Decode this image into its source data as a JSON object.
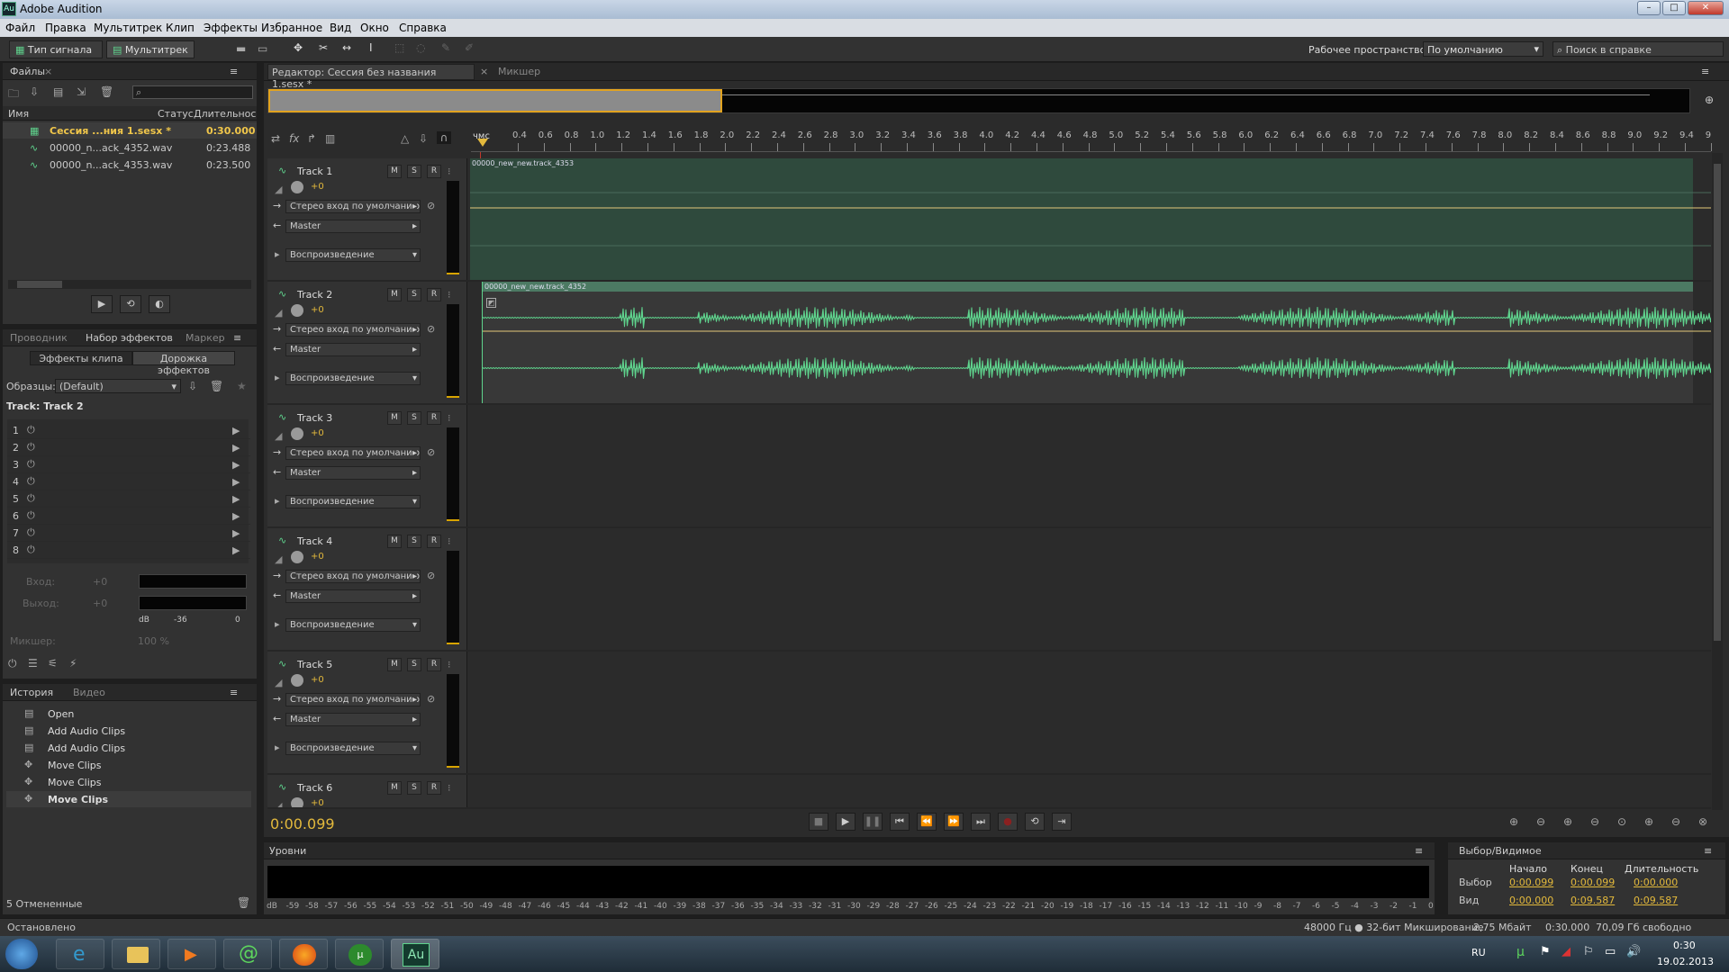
{
  "window": {
    "title": "Adobe Audition",
    "min": "–",
    "max": "□",
    "close": "✕"
  },
  "menu": [
    "Файл",
    "Правка",
    "Мультитрек",
    "Клип",
    "Эффекты",
    "Избранное",
    "Вид",
    "Окно",
    "Справка"
  ],
  "toolbar": {
    "waveform": "Тип сигнала",
    "multitrack": "Мультитрек",
    "workspace_label": "Рабочее пространство:",
    "workspace_value": "По умолчанию",
    "help_search": "Поиск в справке"
  },
  "files": {
    "tab": "Файлы",
    "columns": [
      "Имя",
      "Статус",
      "Длительнос"
    ],
    "rows": [
      {
        "name": "Сессия ...ния 1.sesx *",
        "duration": "0:30.000"
      },
      {
        "name": "00000_n...ack_4352.wav",
        "duration": "0:23.488"
      },
      {
        "name": "00000_n...ack_4353.wav",
        "duration": "0:23.500"
      }
    ]
  },
  "effects": {
    "tabs": [
      "Проводник",
      "Набор эффектов",
      "Маркер"
    ],
    "subtabs": [
      "Эффекты клипа",
      "Дорожка эффектов"
    ],
    "presets_label": "Образцы:",
    "presets_value": "(Default)",
    "track_label": "Track: Track 2",
    "slots": [
      "1",
      "2",
      "3",
      "4",
      "5",
      "6",
      "7",
      "8"
    ],
    "input_label": "Вход:",
    "output_label": "Выход:",
    "input_val": "+0",
    "output_val": "+0",
    "scale": [
      "dB",
      "-36",
      "0"
    ],
    "mixer_label": "Микшер:",
    "mixer_val": "100 %"
  },
  "history": {
    "tabs": [
      "История",
      "Видео"
    ],
    "items": [
      "Open",
      "Add Audio Clips",
      "Add Audio Clips",
      "Move Clips",
      "Move Clips",
      "Move Clips"
    ],
    "undo_count": "5 Отмененные"
  },
  "editor": {
    "tab": "Редактор: Сессия без названия 1.sesx *",
    "mixer_tab": "Микшер",
    "ruler_unit": "чмс",
    "ruler": [
      "0.4",
      "0.6",
      "0.8",
      "1.0",
      "1.2",
      "1.4",
      "1.6",
      "1.8",
      "2.0",
      "2.2",
      "2.4",
      "2.6",
      "2.8",
      "3.0",
      "3.2",
      "3.4",
      "3.6",
      "3.8",
      "4.0",
      "4.2",
      "4.4",
      "4.6",
      "4.8",
      "5.0",
      "5.2",
      "5.4",
      "5.6",
      "5.8",
      "6.0",
      "6.2",
      "6.4",
      "6.6",
      "6.8",
      "7.0",
      "7.2",
      "7.4",
      "7.6",
      "7.8",
      "8.0",
      "8.2",
      "8.4",
      "8.6",
      "8.8",
      "9.0",
      "9.2",
      "9.4",
      "9"
    ],
    "time": "0:00.099"
  },
  "tracks": [
    {
      "name": "Track 1",
      "vol": "+0",
      "input": "Стерео вход по умолчанию",
      "output": "Master",
      "mode": "Воспроизведение",
      "clip": "00000_new_new.track_4353"
    },
    {
      "name": "Track 2",
      "vol": "+0",
      "input": "Стерео вход по умолчанию",
      "output": "Master",
      "mode": "Воспроизведение",
      "clip": "00000_new_new.track_4352"
    },
    {
      "name": "Track 3",
      "vol": "+0",
      "input": "Стерео вход по умолчанию",
      "output": "Master",
      "mode": "Воспроизведение"
    },
    {
      "name": "Track 4",
      "vol": "+0",
      "input": "Стерео вход по умолчанию",
      "output": "Master",
      "mode": "Воспроизведение"
    },
    {
      "name": "Track 5",
      "vol": "+0",
      "input": "Стерео вход по умолчанию",
      "output": "Master",
      "mode": "Воспроизведение"
    },
    {
      "name": "Track 6",
      "vol": "+0"
    }
  ],
  "track_buttons": [
    "M",
    "S",
    "R"
  ],
  "levels": {
    "tab": "Уровни",
    "scale": [
      "dB",
      "-59",
      "-58",
      "-57",
      "-56",
      "-55",
      "-54",
      "-53",
      "-52",
      "-51",
      "-50",
      "-49",
      "-48",
      "-47",
      "-46",
      "-45",
      "-44",
      "-43",
      "-42",
      "-41",
      "-40",
      "-39",
      "-38",
      "-37",
      "-36",
      "-35",
      "-34",
      "-33",
      "-32",
      "-31",
      "-30",
      "-29",
      "-28",
      "-27",
      "-26",
      "-25",
      "-24",
      "-23",
      "-22",
      "-21",
      "-20",
      "-19",
      "-18",
      "-17",
      "-16",
      "-15",
      "-14",
      "-13",
      "-12",
      "-11",
      "-10",
      "-9",
      "-8",
      "-7",
      "-6",
      "-5",
      "-4",
      "-3",
      "-2",
      "-1",
      "0"
    ]
  },
  "selection": {
    "tab": "Выбор/Видимое",
    "headers": [
      "Начало",
      "Конец",
      "Длительность"
    ],
    "sel_label": "Выбор",
    "view_label": "Вид",
    "sel": [
      "0:00.099",
      "0:00.099",
      "0:00.000"
    ],
    "view": [
      "0:00.000",
      "0:09.587",
      "0:09.587"
    ]
  },
  "status": {
    "left": "Остановлено",
    "rate": "48000 Гц ● 32-бит Микширование",
    "size": "2,75 Мбайт",
    "dur": "0:30.000",
    "free": "70,09 Гб свободно"
  },
  "taskbar": {
    "lang": "RU",
    "time": "0:30",
    "date": "19.02.2013",
    "au": "Au"
  }
}
